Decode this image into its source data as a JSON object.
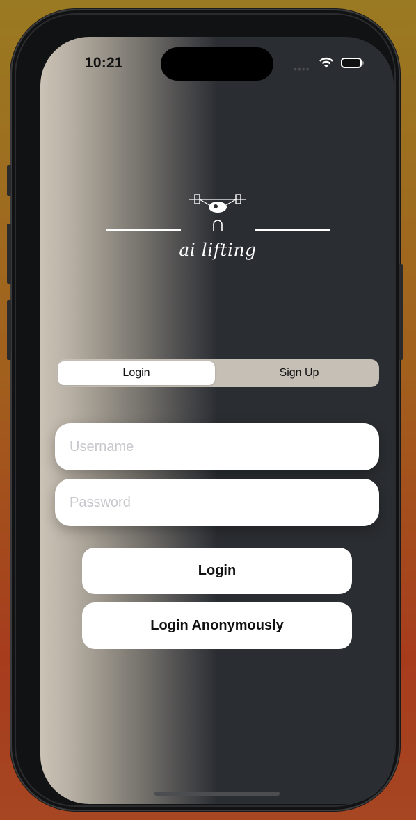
{
  "status_bar": {
    "time": "10:21",
    "signal_icon": "cellular-dots-icon",
    "wifi_icon": "wifi-icon",
    "battery_icon": "battery-icon"
  },
  "logo": {
    "text": "ai lifting",
    "icon": "weightlifter-icon"
  },
  "tabs": [
    {
      "label": "Login",
      "selected": true
    },
    {
      "label": "Sign Up",
      "selected": false
    }
  ],
  "form": {
    "username": {
      "placeholder": "Username",
      "value": ""
    },
    "password": {
      "placeholder": "Password",
      "value": ""
    }
  },
  "buttons": {
    "login": "Login",
    "anonymous": "Login Anonymously"
  },
  "colors": {
    "screen_dark": "#2a2d31",
    "screen_light": "#cbc2b5",
    "segment_bg": "#c5bfb6",
    "button_bg": "#ffffff"
  }
}
